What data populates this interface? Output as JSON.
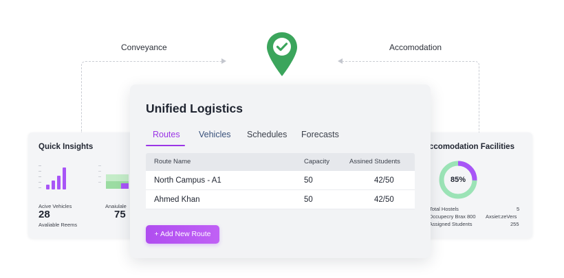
{
  "flow": {
    "left_label": "Conveyance",
    "right_label": "Accomodation"
  },
  "quick_insights": {
    "title": "Quick Insights",
    "active_label": "Acive Vehicles",
    "active_value": "28",
    "available_label": "Avaliable Reems",
    "available_partial_label": "Anaiulale",
    "available_value": "75",
    "bar_values": [
      0.2,
      0.35,
      0.55,
      0.9
    ],
    "accent": "#a855f7"
  },
  "main": {
    "title": "Unified Logistics",
    "tabs": [
      {
        "label": "Routes",
        "active": true
      },
      {
        "label": "Vehicles",
        "active": false
      },
      {
        "label": "Schedules",
        "active": false
      },
      {
        "label": "Forecasts",
        "active": false
      }
    ],
    "table": {
      "headers": [
        "Route Name",
        "Capacity",
        "Assined Students"
      ],
      "rows": [
        {
          "route": "North Campus - A1",
          "capacity": "50",
          "students": "42/50"
        },
        {
          "route": "Ahmed Khan",
          "capacity": "50",
          "students": "42/50"
        }
      ]
    },
    "add_button": "+ Add New Route"
  },
  "accommodation": {
    "title": "ccomodation Facilities",
    "occupancy_percent": 85,
    "occupancy_label": "85%",
    "stats": [
      {
        "label": "Total Hostels",
        "value": "5"
      },
      {
        "label": "Dccupecry Brax 800",
        "value": "Axsiet:zeVers"
      },
      {
        "label": "Assigned Students",
        "value": "255"
      }
    ],
    "ring_color": "#a855f7",
    "ring_secondary": "#9be3b6"
  },
  "colors": {
    "accent": "#a855f7",
    "pin": "#3ba55c"
  },
  "icons": {
    "pin": "location-pin-check-icon"
  }
}
